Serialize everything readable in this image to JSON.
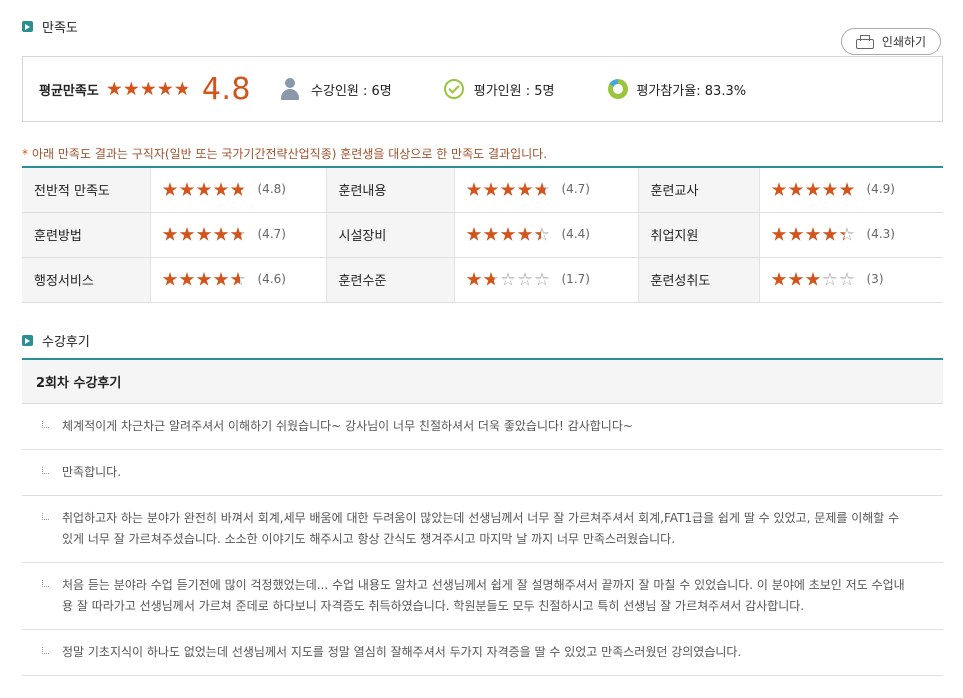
{
  "satisfaction": {
    "title": "만족도",
    "print_label": "인쇄하기",
    "avg_label": "평균만족도",
    "avg_score": "4.8",
    "avg_stars": 4.8,
    "enrolled": "수강인원 : 6명",
    "evaluators": "평가인원 : 5명",
    "participation": "평가참가율: 83.3%"
  },
  "notice": "아래 만족도 결과는 구직자(일반 또는 국가기간전략산업직종) 훈련생을 대상으로 한 만족도 결과입니다.",
  "ratings": [
    [
      {
        "label": "전반적 만족도",
        "stars": 4.8,
        "score": "(4.8)"
      },
      {
        "label": "훈련내용",
        "stars": 4.7,
        "score": "(4.7)"
      },
      {
        "label": "훈련교사",
        "stars": 4.9,
        "score": "(4.9)"
      }
    ],
    [
      {
        "label": "훈련방법",
        "stars": 4.7,
        "score": "(4.7)"
      },
      {
        "label": "시설장비",
        "stars": 4.4,
        "score": "(4.4)"
      },
      {
        "label": "취업지원",
        "stars": 4.3,
        "score": "(4.3)"
      }
    ],
    [
      {
        "label": "행정서비스",
        "stars": 4.6,
        "score": "(4.6)"
      },
      {
        "label": "훈련수준",
        "stars": 1.7,
        "score": "(1.7)"
      },
      {
        "label": "훈련성취도",
        "stars": 3,
        "score": "(3)"
      }
    ]
  ],
  "reviews": {
    "title": "수강후기",
    "round_title": "2회차 수강후기",
    "items": [
      "체계적이게 차근차근 알려주셔서 이해하기 쉬웠습니다~ 강사님이 너무 친절하셔서 더욱 좋았습니다! 감사합니다~",
      "만족합니다.",
      "취업하고자 하는 분야가 완전히 바껴서 회계,세무 배움에 대한 두려움이 많았는데 선생님께서 너무 잘 가르쳐주셔서 회계,FAT1급을 쉽게 딸 수 있었고, 문제를 이해할 수 있게 너무 잘 가르쳐주셨습니다. 소소한 이야기도 해주시고 항상 간식도 챙겨주시고 마지막 날 까지 너무 만족스러웠습니다.",
      "처음 듣는 분야라 수업 듣기전에 많이 걱정했었는데... 수업 내용도 알차고 선생님께서 쉽게 잘 설명해주셔서 끝까지 잘 마칠 수 있었습니다. 이 분야에 초보인 저도 수업내용 잘 따라가고 선생님께서 가르쳐 준데로 하다보니 자격증도 취득하였습니다. 학원분들도 모두 친절하시고 특히 선생님 잘 가르쳐주셔서 감사합니다.",
      "정말 기초지식이 하나도 없었는데 선생님께서 지도를 정말 열심히 잘해주셔서 두가지 자격증을 딸 수 있었고 만족스러웠던 강의였습니다."
    ]
  },
  "colors": {
    "accent": "#2a8f93",
    "star": "#d4551c",
    "score": "#d4551c"
  }
}
